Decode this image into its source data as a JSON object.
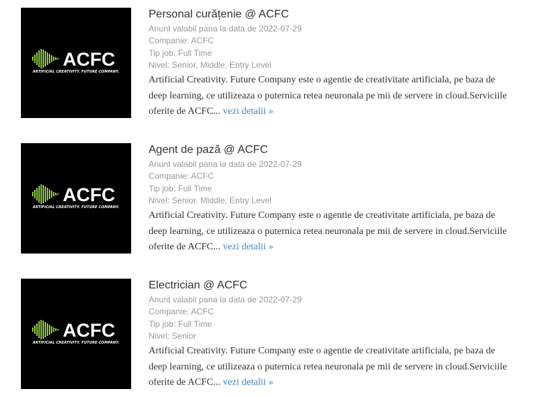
{
  "jobs": [
    {
      "title": "Personal curățenie @ ACFC",
      "valid": "Anunt valabil pana la data de 2022-07-29",
      "company": "Companie: ACFC",
      "job_type": "Tip job: Full Time",
      "level": "Nivel: Senior, Middle, Entry Level",
      "description": "Artificial Creativity. Future Company este o agentie de creativitate artificiala, pe baza de deep learning, ce utilizeaza o puternica retea neuronala pe mii de servere in cloud.Serviciile oferite de ACFC...",
      "more_link": "vezi detalii »",
      "logo": {
        "name": "ACFC",
        "tagline": "ARTIFICIAL CREATIVITY. FUTURE COMPANY."
      }
    },
    {
      "title": "Agent de pază @ ACFC",
      "valid": "Anunt valabil pana la data de 2022-07-29",
      "company": "Companie: ACFC",
      "job_type": "Tip job: Full Time",
      "level": "Nivel: Senior, Middle, Entry Level",
      "description": "Artificial Creativity. Future Company este o agentie de creativitate artificiala, pe baza de deep learning, ce utilizeaza o puternica retea neuronala pe mii de servere in cloud.Serviciile oferite de ACFC...",
      "more_link": "vezi detalii »",
      "logo": {
        "name": "ACFC",
        "tagline": "ARTIFICIAL CREATIVITY. FUTURE COMPANY."
      }
    },
    {
      "title": "Electrician @ ACFC",
      "valid": "Anunt valabil pana la data de 2022-07-29",
      "company": "Companie: ACFC",
      "job_type": "Tip job: Full Time",
      "level": "Nivel: Senior",
      "description": "Artificial Creativity. Future Company este o agentie de creativitate artificiala, pe baza de deep learning, ce utilizeaza o puternica retea neuronala pe mii de servere in cloud.Serviciile oferite de ACFC...",
      "more_link": "vezi detalii »",
      "logo": {
        "name": "ACFC",
        "tagline": "ARTIFICIAL CREATIVITY. FUTURE COMPANY."
      }
    }
  ],
  "colors": {
    "logo_background": "#000000",
    "logo_accent": "#8cc63f",
    "title": "#333333",
    "meta": "#999999",
    "link": "#3b86c4"
  }
}
